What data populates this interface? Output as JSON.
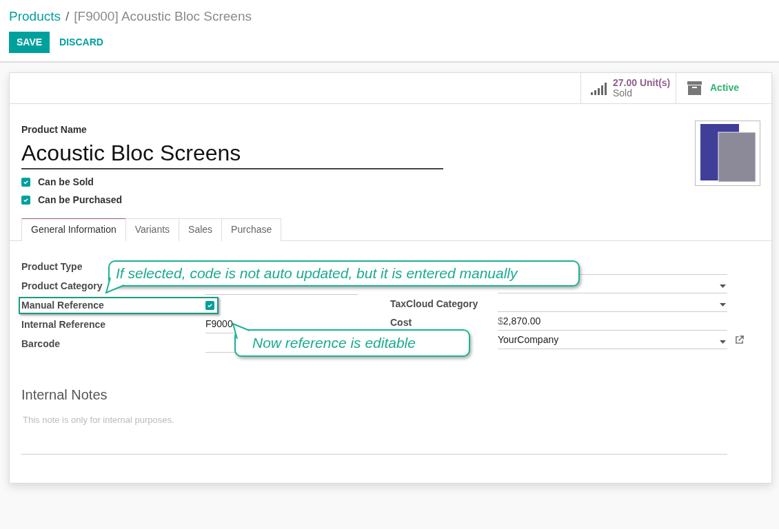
{
  "breadcrumb": {
    "parent": "Products",
    "separator": "/",
    "current": "[F9000] Acoustic Bloc Screens"
  },
  "buttons": {
    "save": "SAVE",
    "discard": "DISCARD"
  },
  "stat_buttons": [
    {
      "kind": "sales",
      "value": "27.00 Unit(s)",
      "label": "Sold"
    },
    {
      "kind": "archive",
      "label": "Active"
    }
  ],
  "product": {
    "name_label": "Product Name",
    "name": "Acoustic Bloc Screens"
  },
  "options": [
    {
      "label": "Can be Sold",
      "checked": true
    },
    {
      "label": "Can be Purchased",
      "checked": true
    }
  ],
  "tabs": [
    {
      "label": "General Information",
      "selected": true
    },
    {
      "label": "Variants",
      "selected": false
    },
    {
      "label": "Sales",
      "selected": false
    },
    {
      "label": "Purchase",
      "selected": false
    }
  ],
  "left_fields": [
    {
      "kind": "text",
      "label": "Product Type",
      "highlighted": false
    },
    {
      "kind": "text",
      "label": "Product Category",
      "highlighted": false
    },
    {
      "kind": "checkbox",
      "label": "Manual Reference",
      "checked": true,
      "highlighted": true
    },
    {
      "kind": "text",
      "label": "Internal Reference",
      "value": "F9000",
      "highlighted": false
    },
    {
      "kind": "text",
      "label": "Barcode",
      "highlighted": false
    }
  ],
  "right_fields": [
    {
      "kind": "text"
    },
    {
      "kind": "select"
    },
    {
      "kind": "select",
      "label": "TaxCloud Category"
    },
    {
      "kind": "money",
      "label": "Cost",
      "currency": "$",
      "value": "2,870.00"
    },
    {
      "kind": "select",
      "value": "YourCompany",
      "link": true
    }
  ],
  "notes": {
    "title": "Internal Notes",
    "placeholder": "This note is only for internal purposes."
  },
  "callouts": [
    {
      "text": "If selected, code is not auto updated, but it is entered manually"
    },
    {
      "text": "Now reference is editable"
    }
  ]
}
